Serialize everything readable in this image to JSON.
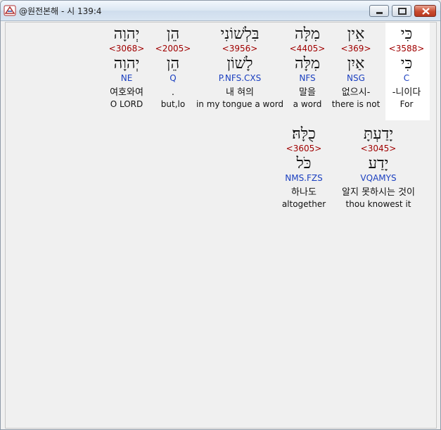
{
  "window": {
    "title": "@원전본해 - 시 139:4"
  },
  "colors": {
    "strong_number": "#a00000",
    "parsing": "#1a3fc0",
    "highlight_panel": "#ffffff"
  },
  "rows": [
    {
      "words": [
        {
          "hebrew": "כִּי",
          "strong": "<3588>",
          "lemma": "כִּי",
          "parse": "C",
          "korean": "-니이다",
          "english": "For"
        },
        {
          "hebrew": "אֵין",
          "strong": "<369>",
          "lemma": "אַיִן",
          "parse": "NSG",
          "korean": "없으시-",
          "english": "there is not"
        },
        {
          "hebrew": "מִלָּה",
          "strong": "<4405>",
          "lemma": "מִלָּה",
          "parse": "NFS",
          "korean": "말을",
          "english": "a word"
        },
        {
          "hebrew": "בִּלְשׁוֹנִי",
          "strong": "<3956>",
          "lemma": "לָשׁוֹן",
          "parse": "P.NFS.CXS",
          "korean": "내 혀의",
          "english": "in my tongue a word"
        },
        {
          "hebrew": "הֵן",
          "strong": "<2005>",
          "lemma": "הֵן",
          "parse": "Q",
          "korean": ".",
          "english": "but,lo"
        },
        {
          "hebrew": "יְהוָה",
          "strong": "<3068>",
          "lemma": "יְהוָה",
          "parse": "NE",
          "korean": "여호와여",
          "english": "O LORD"
        }
      ]
    },
    {
      "words": [
        {
          "hebrew": "יָדַעְתָּ",
          "strong": "<3045>",
          "lemma": "יָדַע",
          "parse": "VQAMYS",
          "korean": "알지 못하시는 것이",
          "english": "thou knowest it"
        },
        {
          "hebrew": "כֻלָּהּ׃",
          "strong": "<3605>",
          "lemma": "כֹּל",
          "parse": "NMS.FZS",
          "korean": "하나도",
          "english": "altogether"
        }
      ]
    }
  ]
}
